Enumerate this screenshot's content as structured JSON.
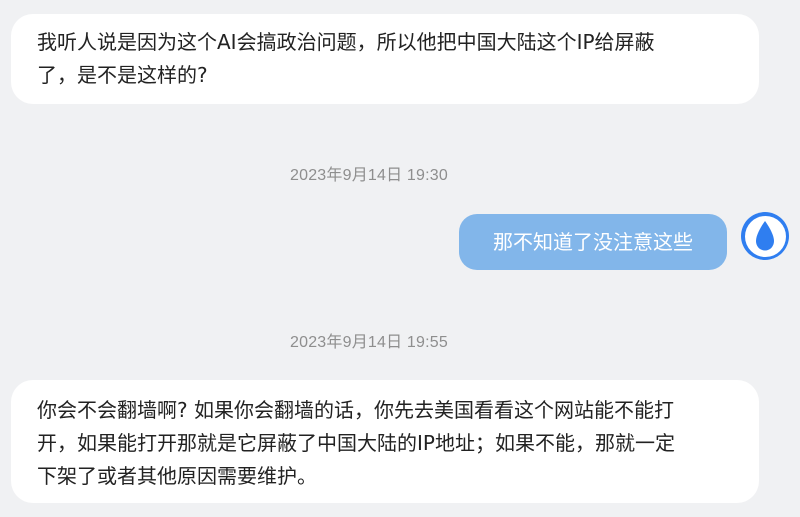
{
  "messages": [
    {
      "sender": "other",
      "lines": [
        "我听人说是因为这个AI会搞政治问题，所以他把中国大陆这个IP给屏蔽",
        "了，是不是这样的?"
      ]
    },
    {
      "sender": "me",
      "timestamp": "2023年9月14日 19:30",
      "text": "那不知道了没注意这些"
    },
    {
      "sender": "other",
      "timestamp": "2023年9月14日 19:55",
      "lines": [
        "你会不会翻墙啊? 如果你会翻墙的话，你先去美国看看这个网站能不能打",
        "开，如果能打开那就是它屏蔽了中国大陆的IP地址；如果不能，那就一定",
        "下架了或者其他原因需要维护。"
      ]
    }
  ],
  "avatar": {
    "icon": "water-drop-icon",
    "color": "#2f7ef0"
  },
  "colors": {
    "background": "#f0f1f3",
    "incoming_bubble": "#ffffff",
    "outgoing_bubble": "#82b6ea",
    "timestamp_text": "#8e8e8e"
  }
}
